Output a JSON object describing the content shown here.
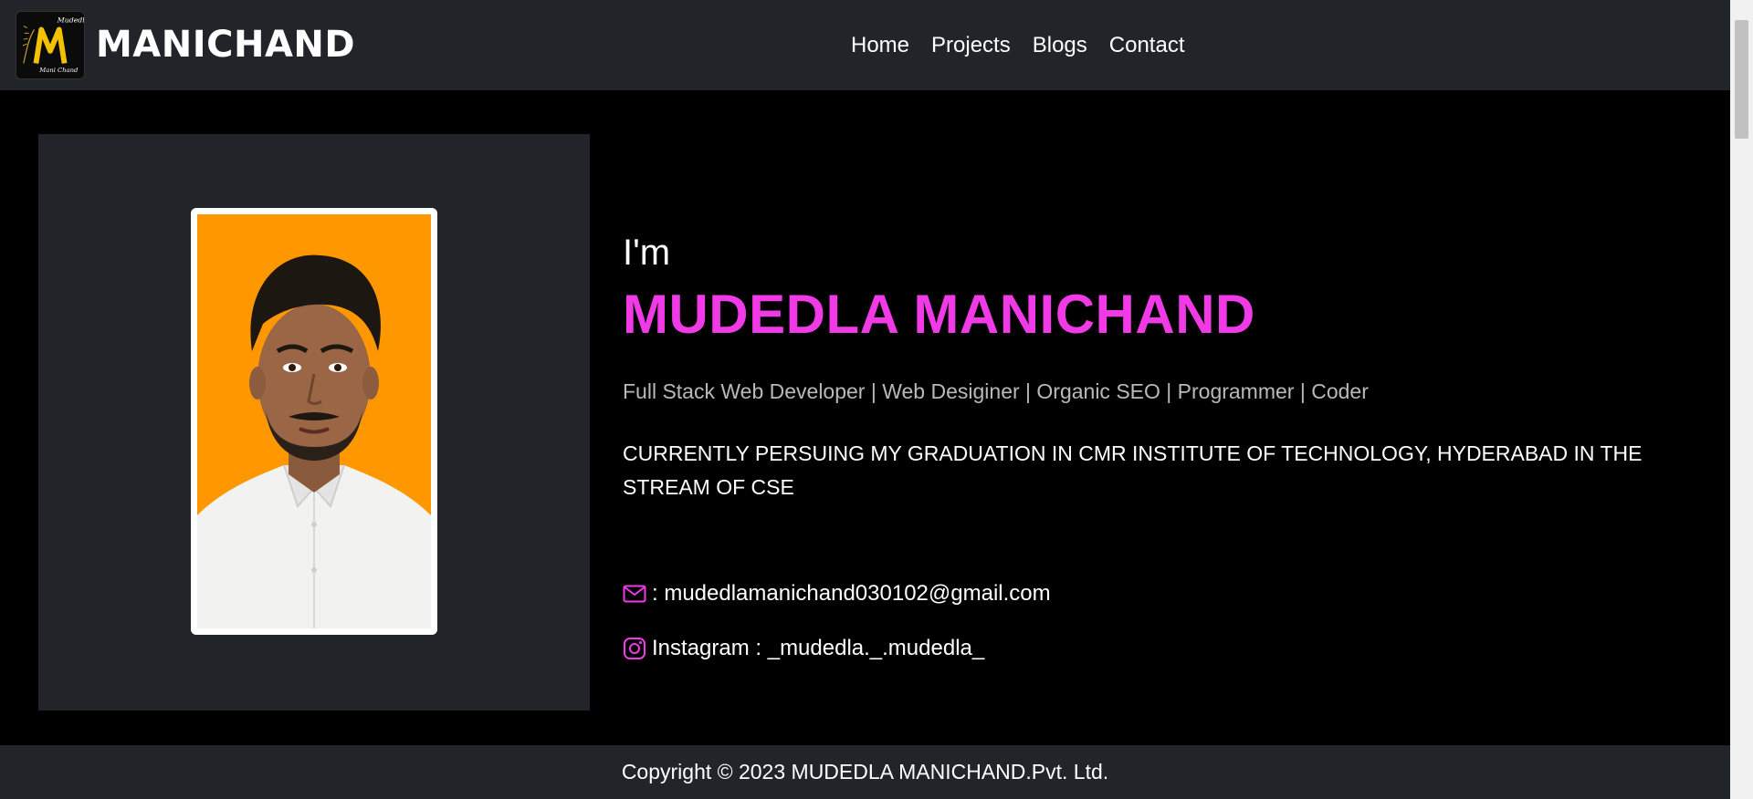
{
  "header": {
    "brand_name": "MANICHAND",
    "logo_text_top": "Mudedla",
    "logo_letter": "M",
    "logo_text_bottom": "Mani Chand",
    "nav": [
      {
        "label": "Home"
      },
      {
        "label": "Projects"
      },
      {
        "label": "Blogs"
      },
      {
        "label": "Contact"
      }
    ]
  },
  "hero": {
    "intro": "I'm",
    "name": "MUDEDLA MANICHAND",
    "roles": "Full Stack Web Developer | Web Desiginer | Organic SEO | Programmer | Coder",
    "education": "CURRENTLY PERSUING MY GRADUATION IN CMR INSTITUTE OF TECHNOLOGY, HYDERABAD IN THE STREAM OF CSE",
    "email_line": ": mudedlamanichand030102@gmail.com",
    "instagram_line": "Instagram : _mudedla._.mudedla_",
    "email_icon": "envelope-icon",
    "instagram_icon": "instagram-icon"
  },
  "footer": {
    "copyright": "Copyright © 2023 MUDEDLA MANICHAND.Pvt. Ltd."
  },
  "colors": {
    "navbar_bg": "#212529",
    "page_bg": "#000000",
    "accent": "#f03ae6",
    "photo_bg": "#ff9800",
    "muted_text": "#b9b9b9"
  }
}
